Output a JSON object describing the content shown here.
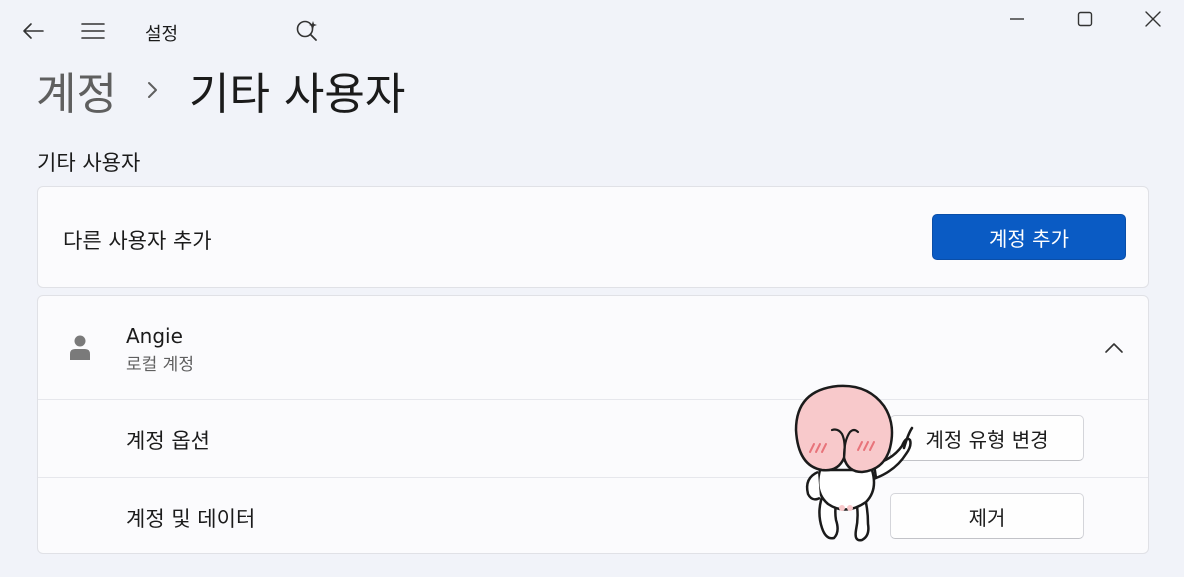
{
  "app": {
    "title": "설정"
  },
  "breadcrumb": {
    "parent": "계정",
    "current": "기타 사용자"
  },
  "section": {
    "title": "기타 사용자"
  },
  "add_user": {
    "label": "다른 사용자 추가",
    "button": "계정 추가"
  },
  "user": {
    "name": "Angie",
    "type": "로컬 계정",
    "rows": [
      {
        "label": "계정 옵션",
        "button": "계정 유형 변경"
      },
      {
        "label": "계정 및 데이터",
        "button": "제거"
      }
    ]
  },
  "colors": {
    "accent": "#0a5bc4",
    "background": "#f1f3f9",
    "card": "#fbfbfd",
    "sticker_pink": "#f8c9cb"
  },
  "icons": [
    "back-arrow-icon",
    "hamburger-menu-icon",
    "search-copilot-icon",
    "minimize-icon",
    "maximize-icon",
    "close-icon",
    "chevron-right-icon",
    "person-icon",
    "chevron-up-icon",
    "peach-sticker"
  ]
}
